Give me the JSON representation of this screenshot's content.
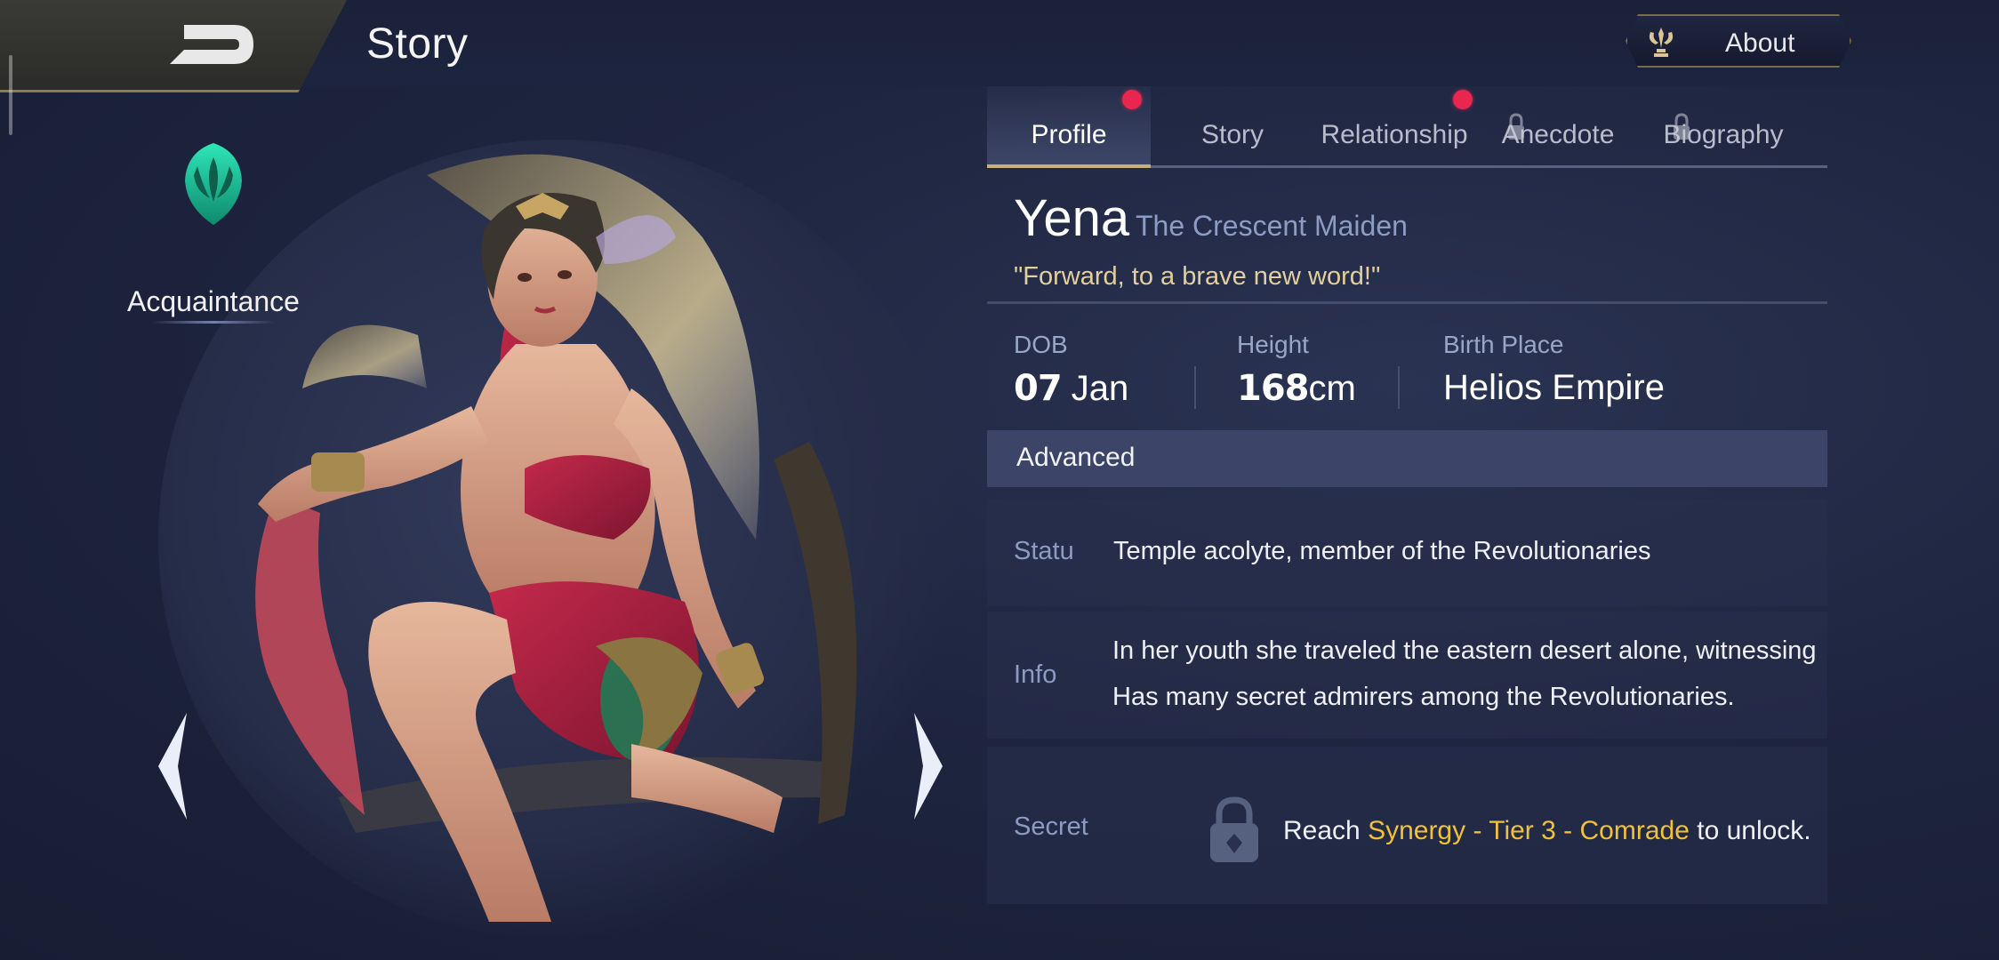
{
  "header": {
    "title": "Story",
    "about_label": "About"
  },
  "hero_view": {
    "relationship_rank": "Acquaintance"
  },
  "tabs": [
    {
      "label": "Profile",
      "active": true,
      "notification": true,
      "locked": false
    },
    {
      "label": "Story",
      "active": false,
      "notification": false,
      "locked": false
    },
    {
      "label": "Relationship",
      "active": false,
      "notification": true,
      "locked": false
    },
    {
      "label": "Anecdote",
      "active": false,
      "notification": false,
      "locked": true
    },
    {
      "label": "Biography",
      "active": false,
      "notification": false,
      "locked": true
    }
  ],
  "profile": {
    "name": "Yena",
    "epithet": "The Crescent Maiden",
    "quote": "\"Forward, to a brave new word!\"",
    "dob": {
      "label": "DOB",
      "day": "07",
      "month": "Jan"
    },
    "height": {
      "label": "Height",
      "value": "168",
      "unit": "cm"
    },
    "birthplace": {
      "label": "Birth Place",
      "value": "Helios Empire"
    },
    "advanced_label": "Advanced",
    "status": {
      "label": "Statu",
      "text": "Temple acolyte, member of the Revolutionaries"
    },
    "info": {
      "label": "Info",
      "line1": "In her youth she traveled the eastern desert alone, witnessing",
      "line2": "Has many secret admirers among the Revolutionaries."
    },
    "secret": {
      "label": "Secret",
      "prefix": "Reach",
      "requirement_a": "Synergy - Tier",
      "tier": "3",
      "requirement_b": "- Comrade",
      "suffix": "to unlock."
    }
  },
  "colors": {
    "accent_gold": "#c9b07a",
    "highlight_yellow": "#f2c13a",
    "notification_red": "#e8264f",
    "quote_color": "#e2cf9c",
    "label_blue": "#8d9bc2"
  }
}
